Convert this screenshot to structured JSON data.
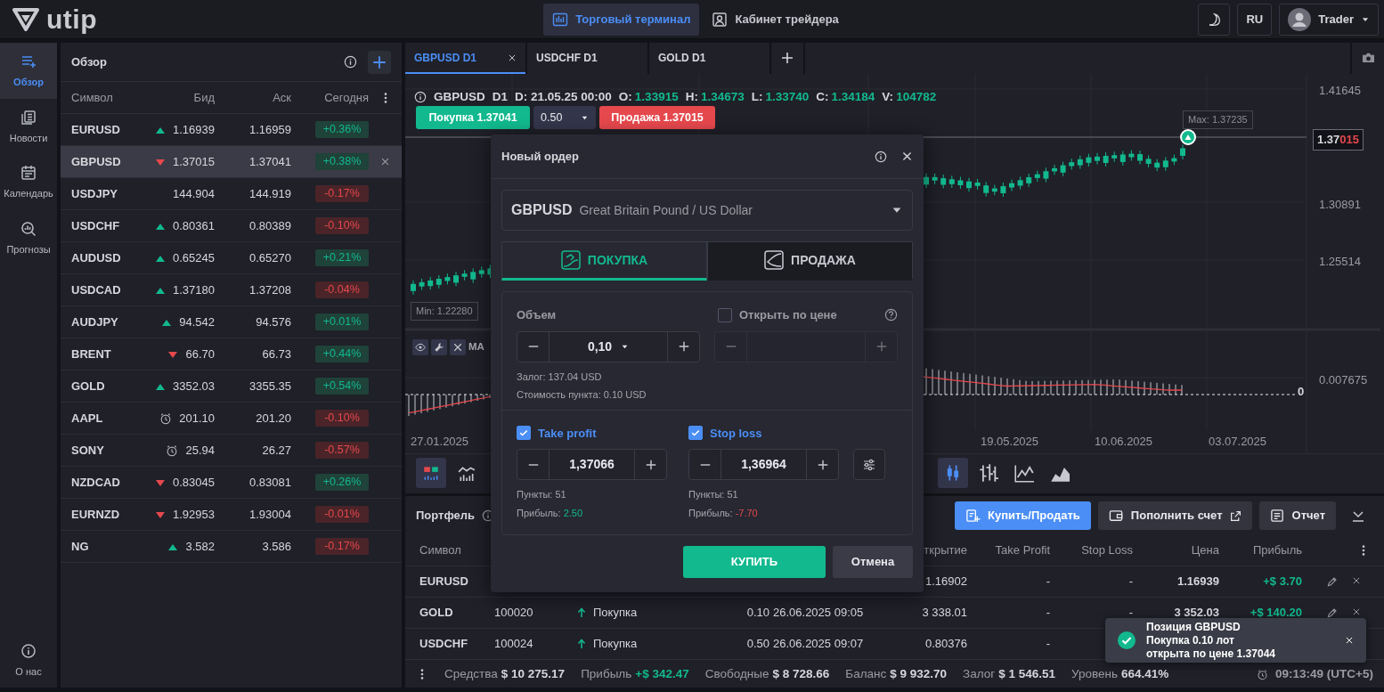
{
  "header": {
    "logo": "utip",
    "tabs": [
      {
        "label": "Торговый терминал",
        "kind": "terminal",
        "selected": true
      },
      {
        "label": "Кабинет трейдера",
        "kind": "cabinet",
        "selected": false
      }
    ],
    "language": "RU",
    "user": "Trader"
  },
  "nav": [
    {
      "label": "Обзор",
      "kind": "overview",
      "selected": true
    },
    {
      "label": "Новости",
      "kind": "news",
      "selected": false
    },
    {
      "label": "Календарь",
      "kind": "calendar",
      "selected": false
    },
    {
      "label": "Прогнозы",
      "kind": "forecasts",
      "selected": false
    },
    {
      "label": "О нас",
      "kind": "about",
      "selected": false
    }
  ],
  "watchlist": {
    "title": "Обзор",
    "columns": [
      "Символ",
      "Бид",
      "Аск",
      "Сегодня"
    ],
    "rows": [
      {
        "symbol": "EURUSD",
        "kind": "up",
        "bid": "1.16939",
        "ask": "1.16959",
        "change": "+0.36%",
        "positive": true,
        "selected": false
      },
      {
        "symbol": "GBPUSD",
        "kind": "down",
        "bid": "1.37015",
        "ask": "1.37041",
        "change": "+0.38%",
        "positive": true,
        "selected": true
      },
      {
        "symbol": "USDJPY",
        "bid": "144.904",
        "ask": "144.919",
        "change": "-0.17%",
        "positive": false,
        "selected": false
      },
      {
        "symbol": "USDCHF",
        "kind": "up",
        "bid": "0.80361",
        "ask": "0.80389",
        "change": "-0.10%",
        "positive": false,
        "selected": false
      },
      {
        "symbol": "AUDUSD",
        "kind": "up",
        "bid": "0.65245",
        "ask": "0.65270",
        "change": "+0.21%",
        "positive": true,
        "selected": false
      },
      {
        "symbol": "USDCAD",
        "kind": "up",
        "bid": "1.37180",
        "ask": "1.37208",
        "change": "-0.04%",
        "positive": false,
        "selected": false
      },
      {
        "symbol": "AUDJPY",
        "kind": "up",
        "bid": "94.542",
        "ask": "94.576",
        "change": "+0.01%",
        "positive": true,
        "selected": false
      },
      {
        "symbol": "BRENT",
        "kind": "down",
        "bid": "66.70",
        "ask": "66.73",
        "change": "+0.44%",
        "positive": true,
        "selected": false
      },
      {
        "symbol": "GOLD",
        "kind": "up",
        "bid": "3352.03",
        "ask": "3355.35",
        "change": "+0.54%",
        "positive": true,
        "selected": false
      },
      {
        "symbol": "AAPL",
        "kind": "closed",
        "bid": "201.10",
        "ask": "201.20",
        "change": "-0.10%",
        "positive": false,
        "selected": false
      },
      {
        "symbol": "SONY",
        "kind": "closed",
        "bid": "25.94",
        "ask": "26.27",
        "change": "-0.57%",
        "positive": false,
        "selected": false
      },
      {
        "symbol": "NZDCAD",
        "kind": "down",
        "bid": "0.83045",
        "ask": "0.83081",
        "change": "+0.26%",
        "positive": true,
        "selected": false
      },
      {
        "symbol": "EURNZD",
        "kind": "down",
        "bid": "1.92953",
        "ask": "1.93004",
        "change": "-0.01%",
        "positive": false,
        "selected": false
      },
      {
        "symbol": "NG",
        "kind": "up",
        "bid": "3.582",
        "ask": "3.586",
        "change": "-0.17%",
        "positive": false,
        "selected": false
      }
    ]
  },
  "chart_tabs": [
    {
      "label": "GBPUSD D1",
      "selected": true,
      "closable": true
    },
    {
      "label": "USDCHF D1",
      "selected": false,
      "closable": false
    },
    {
      "label": "GOLD D1",
      "selected": false,
      "closable": false
    }
  ],
  "chart": {
    "symbol": "GBPUSD",
    "timeframe": "D1",
    "date": "D: 21.05.25 00:00",
    "ohlcv": [
      {
        "label": "O:",
        "value": "1.33915"
      },
      {
        "label": "H:",
        "value": "1.34673"
      },
      {
        "label": "L:",
        "value": "1.33740"
      },
      {
        "label": "C:",
        "value": "1.34184"
      },
      {
        "label": "V:",
        "value": "104782"
      }
    ],
    "buy_button": "Покупка 1.37041",
    "lot": "0.50",
    "sell_button": "Продажа 1.37015",
    "price_labels": [
      "1.41645",
      "1.30891",
      "1.25514"
    ],
    "price_tag": {
      "major": "1.37",
      "minor": "015"
    },
    "max_label": "Max: 1.37235",
    "min_label": "Min: 1.22280",
    "indicator": {
      "name": "MA",
      "value": "0.007675",
      "zero": "0"
    },
    "date_labels": [
      "27.01.2025",
      "19.05.2025",
      "10.06.2025",
      "03.07.2025"
    ],
    "tools_left": [
      {
        "kind": "candles-volume",
        "selected": true
      },
      {
        "kind": "indicators",
        "selected": false
      }
    ],
    "chart_types": [
      {
        "kind": "candles",
        "selected": true
      },
      {
        "kind": "bars",
        "selected": false
      },
      {
        "kind": "line",
        "selected": false
      },
      {
        "kind": "area",
        "selected": false
      }
    ]
  },
  "portfolio": {
    "title": "Портфель",
    "buttons": [
      {
        "label": "Купить/Продать",
        "kind": "trade"
      },
      {
        "label": "Пополнить счет",
        "kind": "deposit"
      },
      {
        "label": "Отчет",
        "kind": "report"
      }
    ],
    "columns": {
      "symbol": "Символ",
      "open": "ткрытие",
      "take_profit": "Take Profit",
      "stop_loss": "Stop Loss",
      "price": "Цена",
      "profit": "Прибыль"
    },
    "rows": [
      {
        "symbol": "EURUSD",
        "open": "1.16902",
        "take_profit": "-",
        "stop_loss": "-",
        "price": "1.16939",
        "profit": "+$ 3.70",
        "positive": true,
        "editable": true
      },
      {
        "symbol": "GOLD",
        "ticket": "100020",
        "type": "Покупка",
        "kind": "buy",
        "volume": "0.10",
        "time": "26.06.2025 09:05",
        "open": "3 338.01",
        "take_profit": "-",
        "stop_loss": "-",
        "price": "3 352.03",
        "profit": "+$ 140.20",
        "positive": true,
        "editable": true
      },
      {
        "symbol": "USDCHF",
        "ticket": "100024",
        "type": "Покупка",
        "kind": "buy",
        "volume": "0.50",
        "time": "26.06.2025 09:07",
        "open": "0.80376",
        "take_profit": "-",
        "editable": false
      }
    ]
  },
  "status_bar": {
    "items": [
      {
        "label": "Средства",
        "value": "$ 10 275.17",
        "positive": false
      },
      {
        "label": "Прибыль",
        "value": "+$ 342.47",
        "positive": true
      },
      {
        "label": "Свободные",
        "value": "$ 8 728.66",
        "positive": false
      },
      {
        "label": "Баланс",
        "value": "$ 9 932.70",
        "positive": false
      },
      {
        "label": "Залог",
        "value": "$ 1 546.51",
        "positive": false
      },
      {
        "label": "Уровень",
        "value": "664.41%",
        "positive": false
      }
    ],
    "time": "09:13:49 (UTC+5)"
  },
  "order_dialog": {
    "title": "Новый ордер",
    "symbol": "GBPUSD",
    "description": "Great Britain Pound / US Dollar",
    "sides": [
      {
        "label": "ПОКУПКА",
        "kind": "buy",
        "selected": true
      },
      {
        "label": "ПРОДАЖА",
        "kind": "sell",
        "selected": false
      }
    ],
    "volume": {
      "label": "Объем",
      "value": "0,10"
    },
    "open_at_price": {
      "label": "Открыть по цене",
      "checked": false
    },
    "margin_info": "Залог: 137.04 USD",
    "pip_value_info": "Стоимость пункта: 0.10 USD",
    "take_profit": {
      "label": "Take profit",
      "checked": true,
      "value": "1,37066",
      "points": "Пункты: 51",
      "profit_label": "Прибыль:",
      "profit": "2.50",
      "positive": true
    },
    "stop_loss": {
      "label": "Stop loss",
      "checked": true,
      "value": "1,36964",
      "points": "Пункты: 51",
      "profit_label": "Прибыль:",
      "profit": "-7.70",
      "positive": false
    },
    "buttons": [
      {
        "label": "КУПИТЬ",
        "kind": "primary"
      },
      {
        "label": "Отмена",
        "kind": "secondary"
      }
    ]
  },
  "toast": {
    "lines": [
      "Позиция GBPUSD",
      "Покупка 0.10 лот",
      "открыта по цене 1.37044"
    ]
  }
}
